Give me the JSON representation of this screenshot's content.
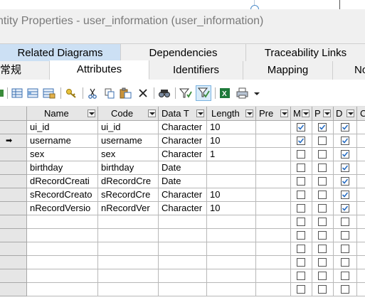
{
  "window": {
    "title": "ntity Properties - user_information (user_information)"
  },
  "tabs_row1": [
    {
      "label": "Related Diagrams"
    },
    {
      "label": "Dependencies"
    },
    {
      "label": "Traceability Links"
    }
  ],
  "tabs_row2": [
    {
      "label": "常规"
    },
    {
      "label": "Attributes"
    },
    {
      "label": "Identifiers"
    },
    {
      "label": "Mapping"
    },
    {
      "label": "No"
    }
  ],
  "toolbar": {
    "icons": [
      "add-row-icon",
      "insert-row-icon",
      "add-attributes-icon",
      "properties-icon",
      "cut-icon",
      "copy-icon",
      "paste-icon",
      "delete-icon",
      "find-icon",
      "filter-icon",
      "customize-columns-icon",
      "excel-export-icon",
      "print-icon",
      "dropdown-arrow-icon"
    ]
  },
  "grid": {
    "columns": [
      {
        "label": "Name"
      },
      {
        "label": "Code"
      },
      {
        "label": "Data T"
      },
      {
        "label": "Length"
      },
      {
        "label": "Pre"
      },
      {
        "label": "M"
      },
      {
        "label": "P"
      },
      {
        "label": "D"
      },
      {
        "label": "C"
      }
    ],
    "rows": [
      {
        "name": "ui_id",
        "code": "ui_id",
        "type": "Character",
        "length": "10",
        "m": true,
        "p": true,
        "d": true,
        "current": false
      },
      {
        "name": "username",
        "code": "username",
        "type": "Character",
        "length": "10",
        "m": true,
        "p": false,
        "d": true,
        "current": true
      },
      {
        "name": "sex",
        "code": "sex",
        "type": "Character",
        "length": "1",
        "m": false,
        "p": false,
        "d": true,
        "current": false
      },
      {
        "name": "birthday",
        "code": "birthday",
        "type": "Date",
        "length": "",
        "m": false,
        "p": false,
        "d": true,
        "current": false
      },
      {
        "name": "dRecordCreati",
        "code": "dRecordCre",
        "type": "Date",
        "length": "",
        "m": false,
        "p": false,
        "d": true,
        "current": false
      },
      {
        "name": "sRecordCreato",
        "code": "sRecordCre",
        "type": "Character",
        "length": "10",
        "m": false,
        "p": false,
        "d": true,
        "current": false
      },
      {
        "name": "nRecordVersio",
        "code": "nRecordVer",
        "type": "Character",
        "length": "10",
        "m": false,
        "p": false,
        "d": true,
        "current": false
      }
    ],
    "empty_rows": 6,
    "check_color": "#2a6fc4"
  }
}
